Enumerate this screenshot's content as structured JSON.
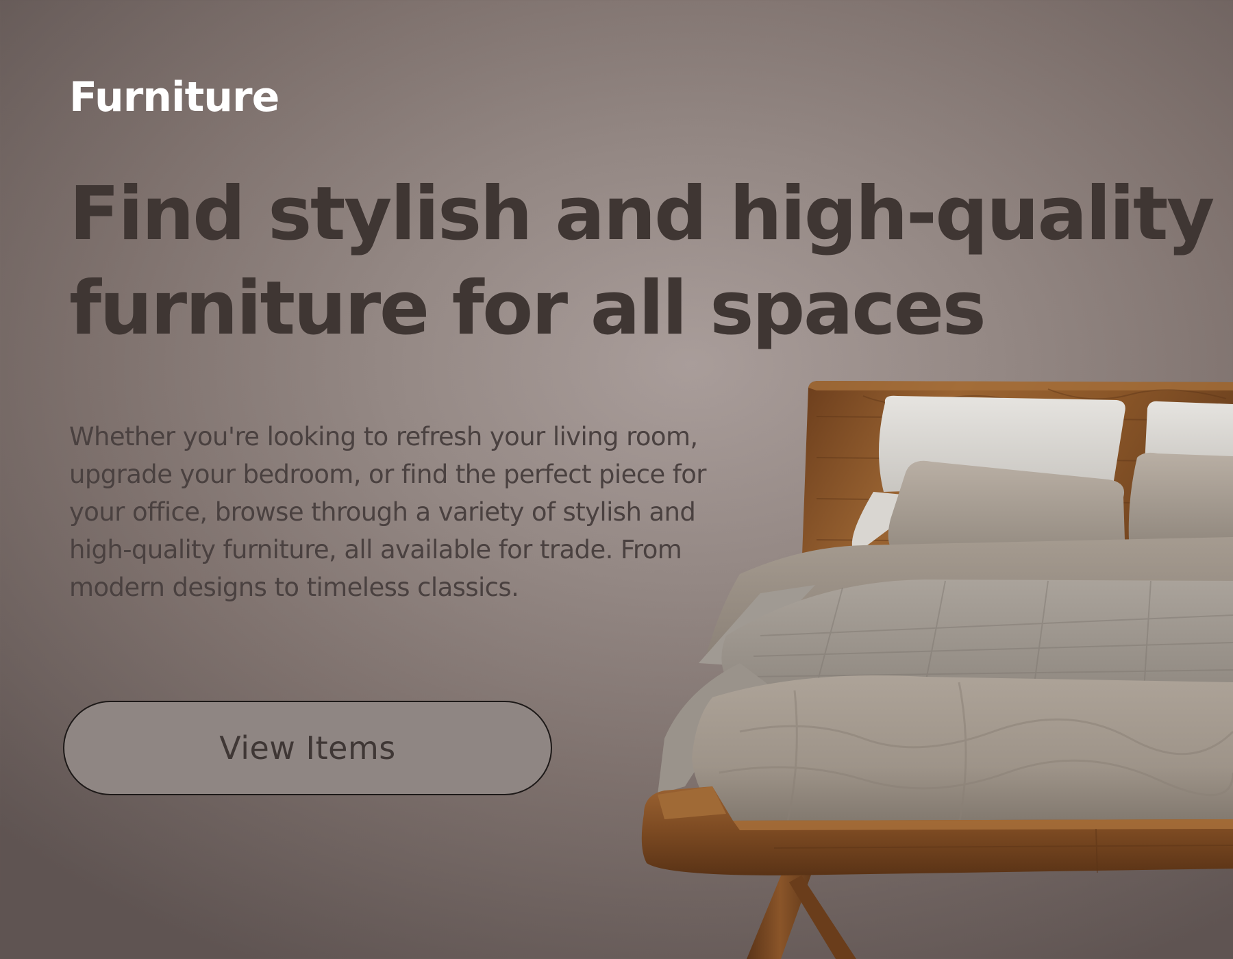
{
  "brand": {
    "title": "Furniture"
  },
  "hero": {
    "headline_lines": [
      "Find stylish and high-quality",
      "furniture for all spaces"
    ],
    "description_lines": [
      "Whether you're looking to refresh your living room,",
      "upgrade your bedroom, or find the perfect piece for",
      "your office, browse through a variety of stylish and",
      "high-quality furniture, all available for trade. From",
      "modern designs to timeless classics."
    ],
    "cta_label": "View Items"
  },
  "image": {
    "subject": "wooden-bed-with-pillows-and-linen-bedding"
  },
  "colors": {
    "headline": "#3f3633",
    "brand": "#ffffff",
    "button_fill": "#8f8683",
    "wood": "#8a5428",
    "linen": "#a69d93"
  }
}
